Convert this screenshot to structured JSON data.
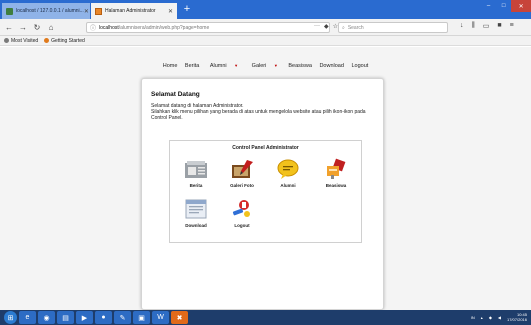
{
  "browser": {
    "tabs": [
      {
        "label": "localhost / 127.0.0.1 / alumni...",
        "active": false
      },
      {
        "label": "Halaman Administrator",
        "active": true
      }
    ],
    "new_tab_label": "+",
    "url_host": "localhost",
    "url_path": "/alumnisera/admin/web.php?page=home",
    "search_placeholder": "Search",
    "bookmarks": [
      "Most Visited",
      "Getting Started"
    ]
  },
  "site": {
    "menu": [
      "Home",
      "Berita",
      "Alumni",
      "Galeri",
      "Beasiswa",
      "Download",
      "Logout"
    ],
    "menu_dropdowns": [
      "Alumni",
      "Galeri"
    ],
    "welcome_title": "Selamat Datang",
    "welcome_line1": "Selamat datang di halaman Administrator.",
    "welcome_line2": "Silahkan klik menu pilihan yang berada di atas untuk mengelola website atau pilih ikon-ikon pada Control Panel.",
    "panel_title": "Control Panel Administrator",
    "panel_items": [
      {
        "label": "Berita",
        "icon": "news-icon"
      },
      {
        "label": "Galeri Foto",
        "icon": "gallery-icon"
      },
      {
        "label": "Alumni",
        "icon": "chat-bubble-icon"
      },
      {
        "label": "Beasiswa",
        "icon": "scholarship-icon"
      },
      {
        "label": "Download",
        "icon": "download-doc-icon"
      },
      {
        "label": "Logout",
        "icon": "logout-icon"
      }
    ]
  },
  "taskbar": {
    "lang": "IN",
    "time": "10:45",
    "date": "17/07/2016"
  },
  "colors": {
    "tabbar": "#2a6bd0",
    "taskbar": "#1e3d6b",
    "page_bg": "#f4f4f4"
  }
}
